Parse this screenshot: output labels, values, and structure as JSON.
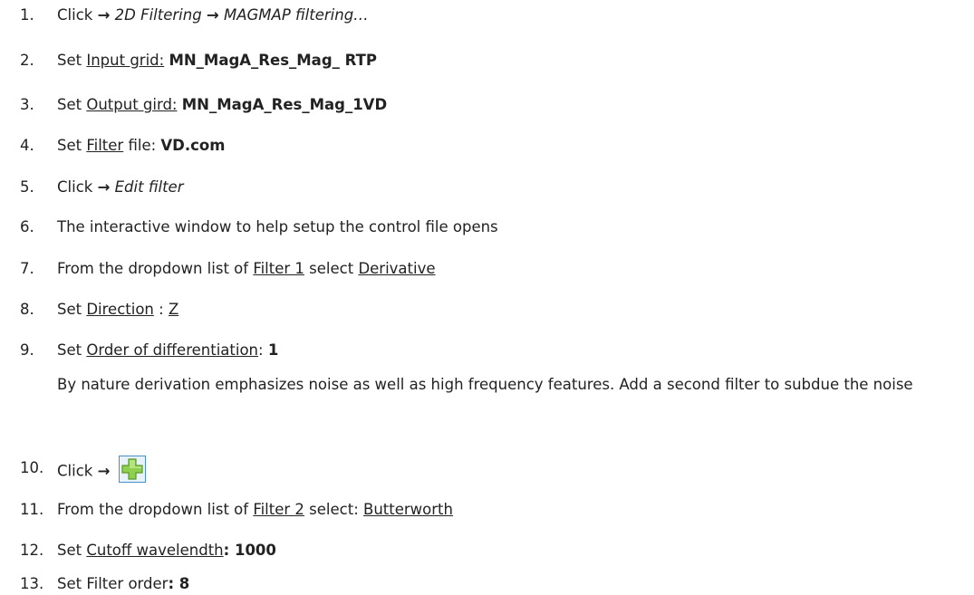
{
  "steps": [
    {
      "n": "1.",
      "parts": [
        {
          "t": "Click "
        },
        {
          "t": "→",
          "cls": "arrow"
        },
        {
          "t": " 2D Filtering ",
          "cls": "i"
        },
        {
          "t": "→",
          "cls": "arrow"
        },
        {
          "t": " MAGMAP filtering…",
          "cls": "i"
        }
      ]
    },
    {
      "n": "2.",
      "parts": [
        {
          "t": "Set "
        },
        {
          "t": "Input grid:",
          "cls": "u"
        },
        {
          "t": "  "
        },
        {
          "t": "MN_MagA_Res_Mag_ RTP",
          "cls": "b"
        }
      ]
    },
    {
      "n": "3.",
      "parts": [
        {
          "t": "Set "
        },
        {
          "t": "Output gird:",
          "cls": "u"
        },
        {
          "t": " "
        },
        {
          "t": "MN_MagA_Res_Mag_1VD",
          "cls": "b"
        }
      ]
    },
    {
      "n": "4.",
      "parts": [
        {
          "t": "Set "
        },
        {
          "t": "Filter",
          "cls": "u"
        },
        {
          "t": " file: "
        },
        {
          "t": "VD.com",
          "cls": "b"
        }
      ]
    },
    {
      "n": "5.",
      "parts": [
        {
          "t": "Click "
        },
        {
          "t": "→",
          "cls": "arrow"
        },
        {
          "t": " Edit filter",
          "cls": "i"
        }
      ]
    },
    {
      "n": "6.",
      "parts": [
        {
          "t": "The interactive window to help setup the control file opens"
        }
      ]
    },
    {
      "n": "7.",
      "parts": [
        {
          "t": "From the dropdown list of "
        },
        {
          "t": "Filter 1",
          "cls": "u"
        },
        {
          "t": " select "
        },
        {
          "t": "Derivative",
          "cls": "u"
        }
      ]
    },
    {
      "n": "8.",
      "parts": [
        {
          "t": "Set "
        },
        {
          "t": "Direction",
          "cls": "u"
        },
        {
          "t": " : "
        },
        {
          "t": "Z",
          "cls": "u"
        }
      ]
    },
    {
      "n": "9.",
      "parts": [
        {
          "t": "Set "
        },
        {
          "t": "Order of differentiation",
          "cls": "u"
        },
        {
          "t": ": "
        },
        {
          "t": "1",
          "cls": "b"
        }
      ]
    },
    {
      "n": "10.",
      "parts": [
        {
          "t": "Click "
        },
        {
          "t": "→",
          "cls": "arrow"
        },
        {
          "t": " "
        }
      ],
      "icon": "green-plus-icon"
    },
    {
      "n": "11.",
      "parts": [
        {
          "t": "From the dropdown list of "
        },
        {
          "t": "Filter 2",
          "cls": "u"
        },
        {
          "t": " select: "
        },
        {
          "t": "Butterworth",
          "cls": "u"
        }
      ]
    },
    {
      "n": "12.",
      "parts": [
        {
          "t": "Set "
        },
        {
          "t": "Cutoff wavelendth",
          "cls": "u"
        },
        {
          "t": ": 1000",
          "cls": "b"
        }
      ]
    },
    {
      "n": "13.",
      "parts": [
        {
          "t": "Set Filter order"
        },
        {
          "t": ": 8",
          "cls": "b"
        }
      ]
    }
  ],
  "note": "By nature derivation emphasizes noise as well as high frequency features.  Add a second filter to subdue the noise",
  "colors": {
    "text": "#222222",
    "plus_fill": "#8fd14f",
    "plus_border": "#4a90c8"
  }
}
